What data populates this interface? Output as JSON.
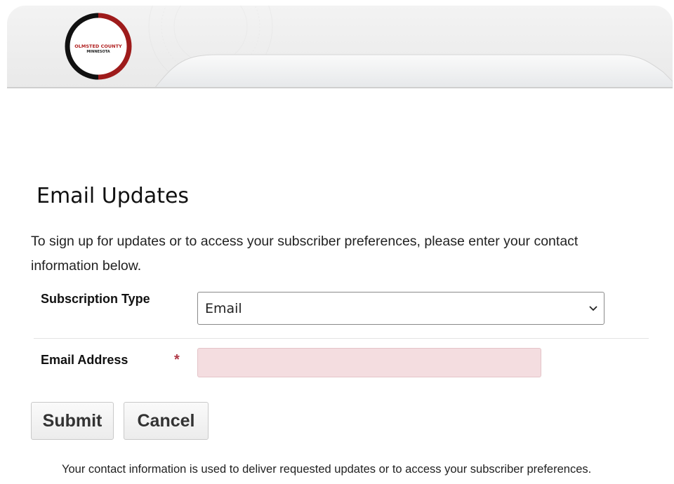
{
  "header": {
    "logo_line1": "OLMSTED COUNTY",
    "logo_line2": "MINNESOTA"
  },
  "page": {
    "title": "Email Updates",
    "intro": "To sign up for updates or to access your subscriber preferences, please enter your contact information below."
  },
  "form": {
    "subscription_type_label": "Subscription Type",
    "subscription_type_value": "Email",
    "email_label": "Email Address",
    "required_marker": "*",
    "email_value": ""
  },
  "buttons": {
    "submit_label": "Submit",
    "cancel_label": "Cancel"
  },
  "footer": {
    "note": "Your contact information is used to deliver requested updates or to access your subscriber preferences."
  },
  "colors": {
    "logo_red": "#b01e1e",
    "required_red": "#b03a48",
    "email_field_bg": "#f4dde0"
  }
}
